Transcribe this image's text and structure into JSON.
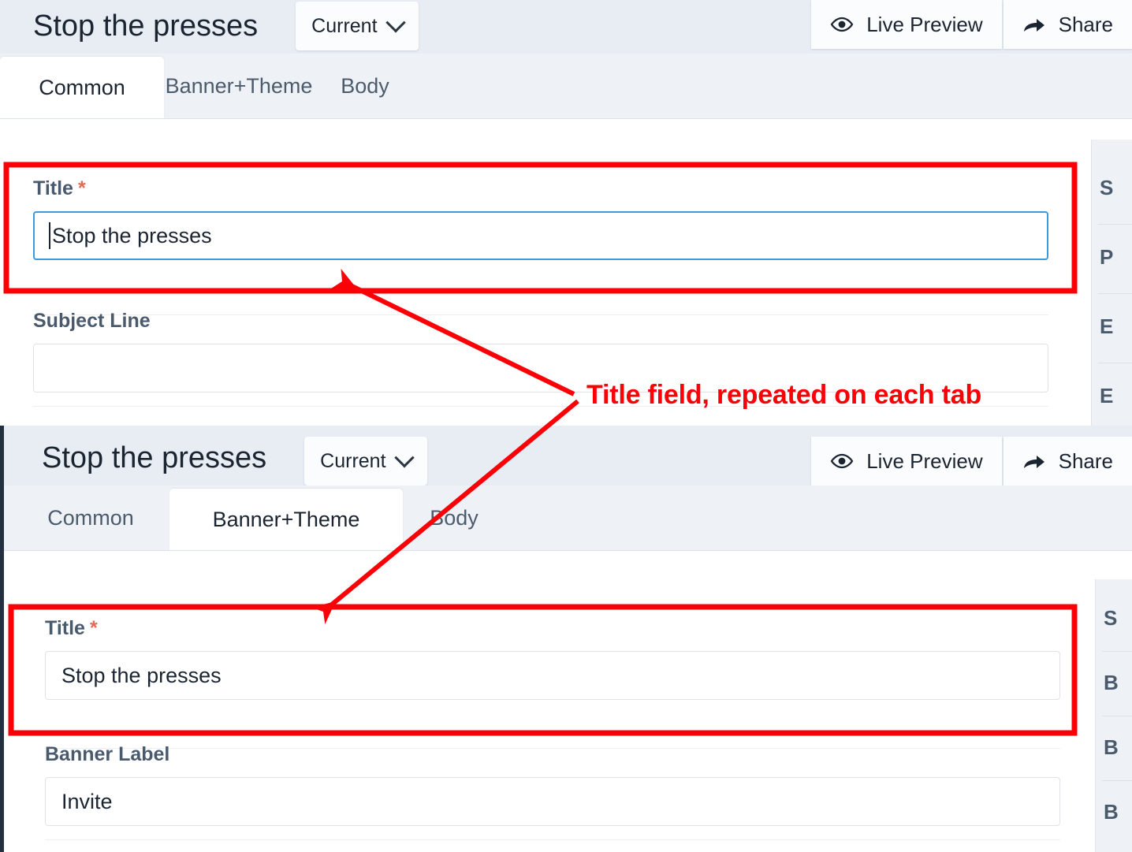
{
  "annotation": {
    "text": "Title field, repeated on each tab",
    "color": "#fb0007"
  },
  "panels": [
    {
      "id": "panel-common",
      "header": {
        "title": "Stop the presses",
        "version_button": "Current",
        "actions": [
          {
            "icon": "eye-icon",
            "label": "Live Preview"
          },
          {
            "icon": "share-arrow-icon",
            "label": "Share"
          }
        ]
      },
      "tabs": [
        {
          "label": "Common",
          "active": true
        },
        {
          "label": "Banner+Theme",
          "active": false
        },
        {
          "label": "Body",
          "active": false
        }
      ],
      "fields": [
        {
          "label": "Title",
          "required": true,
          "required_mark": "*",
          "value": "Stop the presses",
          "placeholder": "",
          "focused": true,
          "highlighted": true
        },
        {
          "label": "Subject Line",
          "required": false,
          "required_mark": "",
          "value": "",
          "placeholder": "",
          "focused": false,
          "highlighted": false
        }
      ],
      "right_rail": [
        "S",
        "P",
        "E",
        "E"
      ]
    },
    {
      "id": "panel-banner-theme",
      "header": {
        "title": "Stop the presses",
        "version_button": "Current",
        "actions": [
          {
            "icon": "eye-icon",
            "label": "Live Preview"
          },
          {
            "icon": "share-arrow-icon",
            "label": "Share"
          }
        ]
      },
      "tabs": [
        {
          "label": "Common",
          "active": false
        },
        {
          "label": "Banner+Theme",
          "active": true
        },
        {
          "label": "Body",
          "active": false
        }
      ],
      "fields": [
        {
          "label": "Title",
          "required": true,
          "required_mark": "*",
          "value": "Stop the presses",
          "placeholder": "",
          "focused": false,
          "highlighted": true
        },
        {
          "label": "Banner Label",
          "required": false,
          "required_mark": "",
          "value": "Invite",
          "placeholder": "",
          "focused": false,
          "highlighted": false
        }
      ],
      "right_rail": [
        "S",
        "B",
        "B",
        "B"
      ]
    }
  ]
}
